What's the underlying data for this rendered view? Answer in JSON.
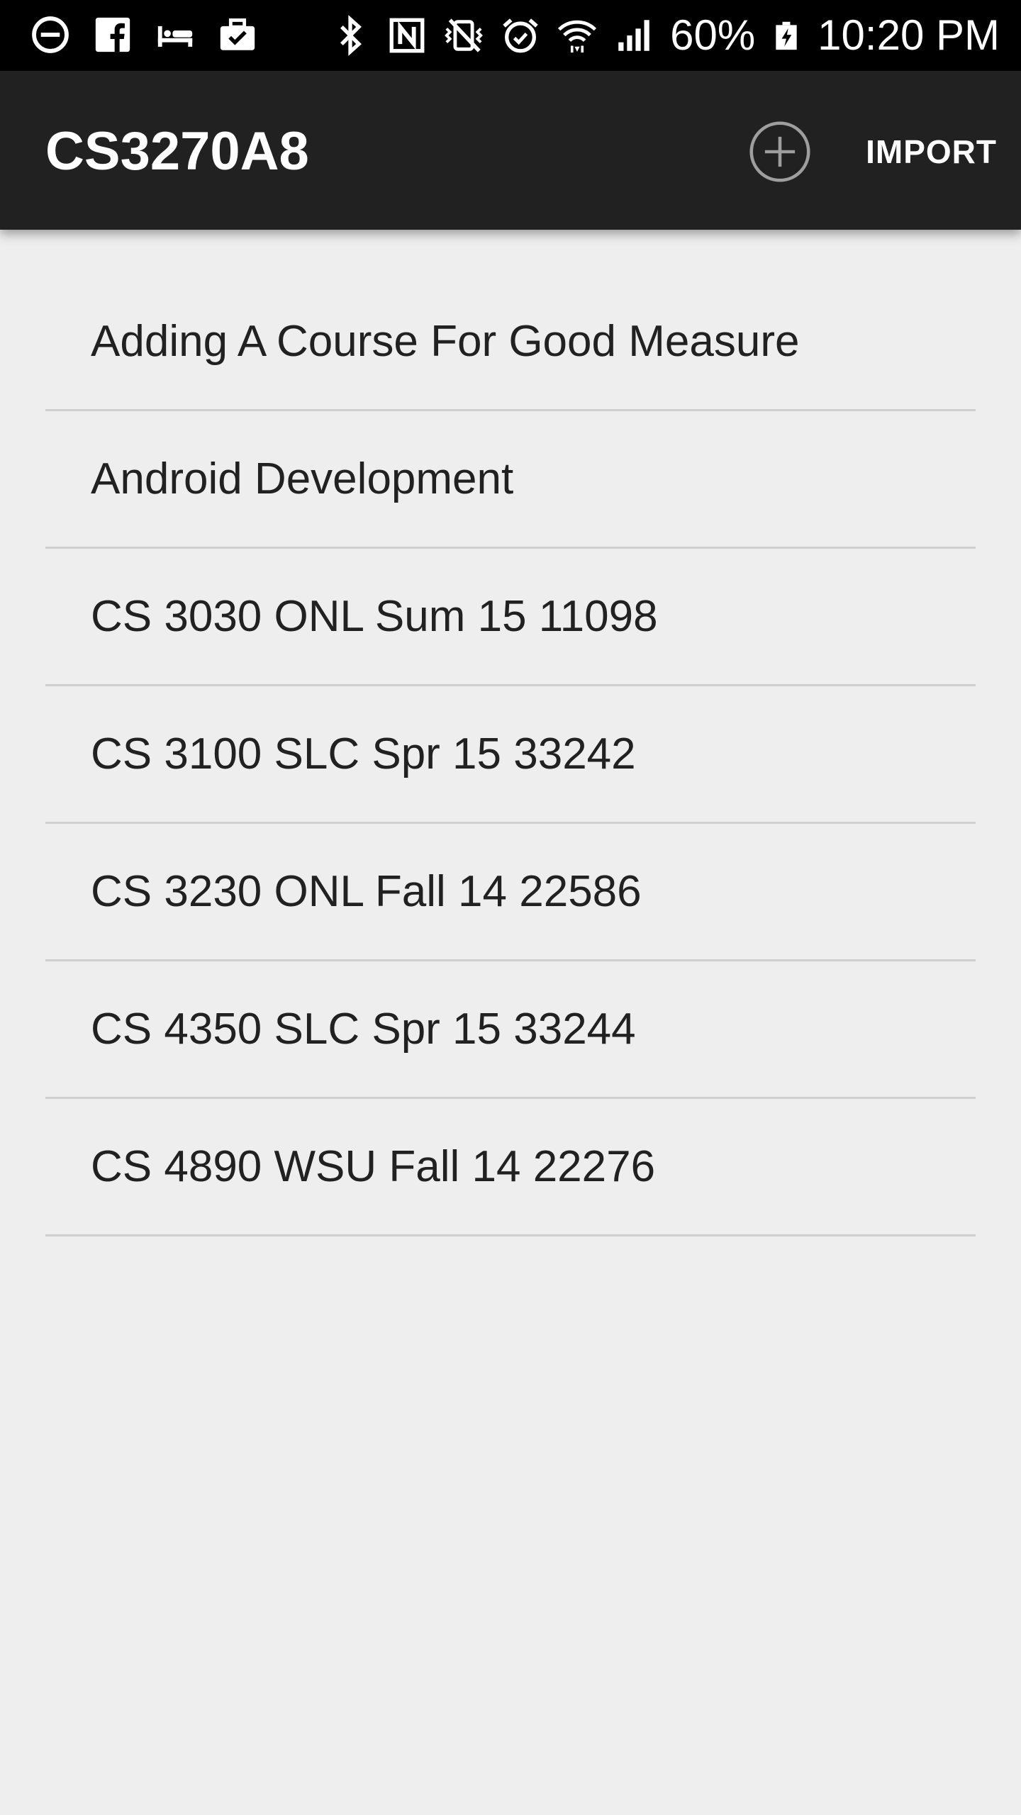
{
  "status_bar": {
    "left_icons": [
      "do-not-disturb-icon",
      "facebook-icon",
      "sleep-bed-icon",
      "briefcase-check-icon"
    ],
    "right_icons": [
      "bluetooth-icon",
      "nfc-icon",
      "vibrate-mute-icon",
      "alarm-icon",
      "wifi-icon",
      "cellular-signal-icon"
    ],
    "battery_percent": "60%",
    "time": "10:20 PM"
  },
  "app_bar": {
    "title": "CS3270A8",
    "add_icon": "add-circle-icon",
    "import_label": "IMPORT"
  },
  "courses": [
    {
      "label": "Adding A Course For Good Measure"
    },
    {
      "label": "Android Development"
    },
    {
      "label": "CS 3030 ONL Sum 15 11098"
    },
    {
      "label": "CS 3100 SLC Spr 15 33242"
    },
    {
      "label": "CS 3230 ONL Fall 14 22586"
    },
    {
      "label": "CS 4350 SLC Spr 15 33244"
    },
    {
      "label": "CS 4890 WSU Fall 14 22276"
    }
  ],
  "colors": {
    "status_bar": "#000000",
    "app_bar": "#212121",
    "background": "#eeeeee",
    "divider": "#cfcfcf",
    "text": "#212121"
  }
}
